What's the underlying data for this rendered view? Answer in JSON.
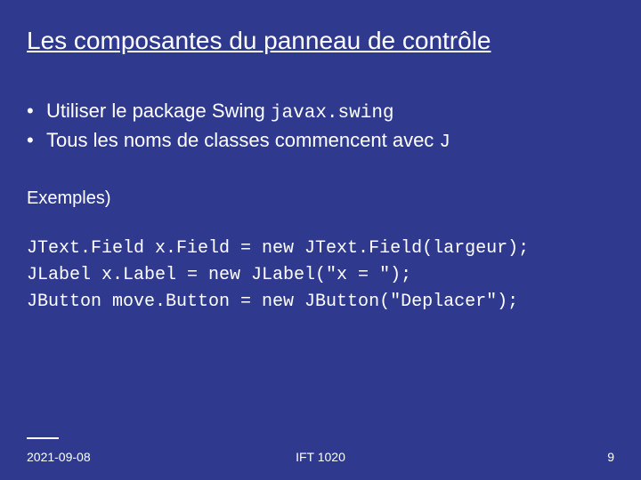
{
  "title": "Les composantes du panneau de contrôle",
  "bullets": {
    "b1_text": "Utiliser le package Swing ",
    "b1_code": "javax.swing",
    "b2_text": "Tous les noms de classes commencent avec ",
    "b2_code": "J"
  },
  "examples_label": "Exemples)",
  "code": {
    "line1": "JText.Field x.Field = new JText.Field(largeur);",
    "line2": "JLabel x.Label = new JLabel(\"x = \");",
    "line3": "JButton move.Button = new JButton(\"Deplacer\");"
  },
  "footer": {
    "date": "2021-09-08",
    "course": "IFT 1020",
    "page": "9"
  }
}
